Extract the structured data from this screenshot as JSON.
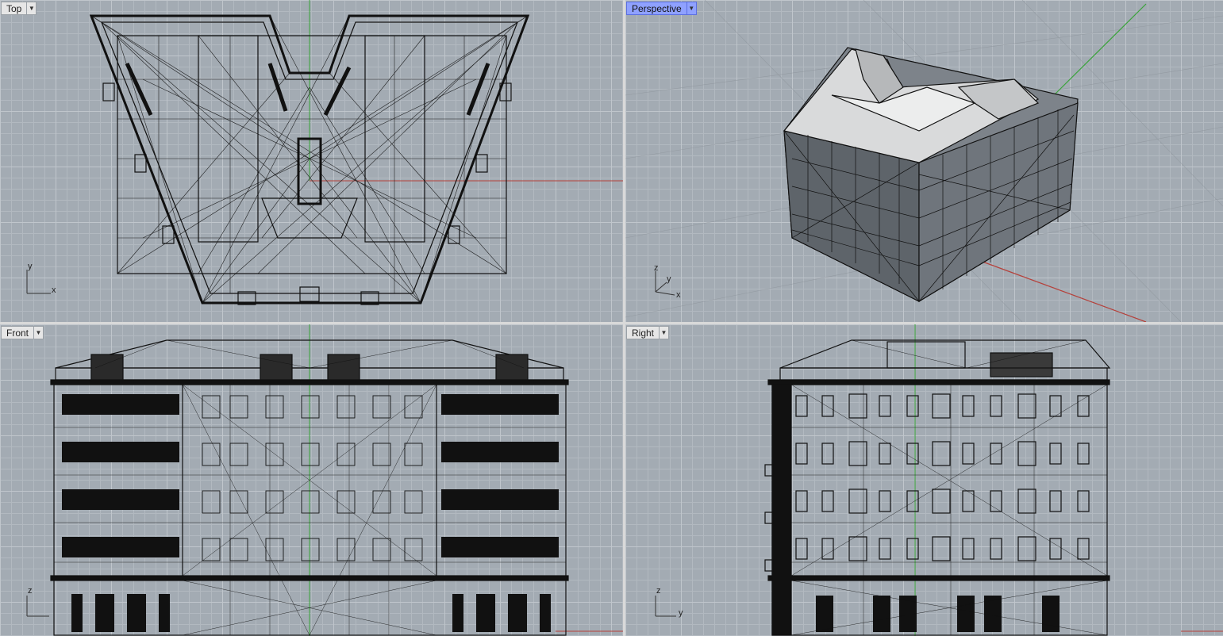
{
  "viewports": {
    "top": {
      "label": "Top",
      "axes": [
        "y",
        "x"
      ]
    },
    "persp": {
      "label": "Perspective",
      "axes": [
        "z",
        "y",
        "x"
      ]
    },
    "front": {
      "label": "Front",
      "axes": [
        "z"
      ]
    },
    "right": {
      "label": "Right",
      "axes": [
        "z",
        "y"
      ]
    }
  },
  "colors": {
    "viewport_bg": "#a3abb3",
    "active_tab": "#8fa1ff",
    "x_axis": "#b5403a",
    "y_axis": "#3aa33a",
    "wire": "#111111"
  }
}
